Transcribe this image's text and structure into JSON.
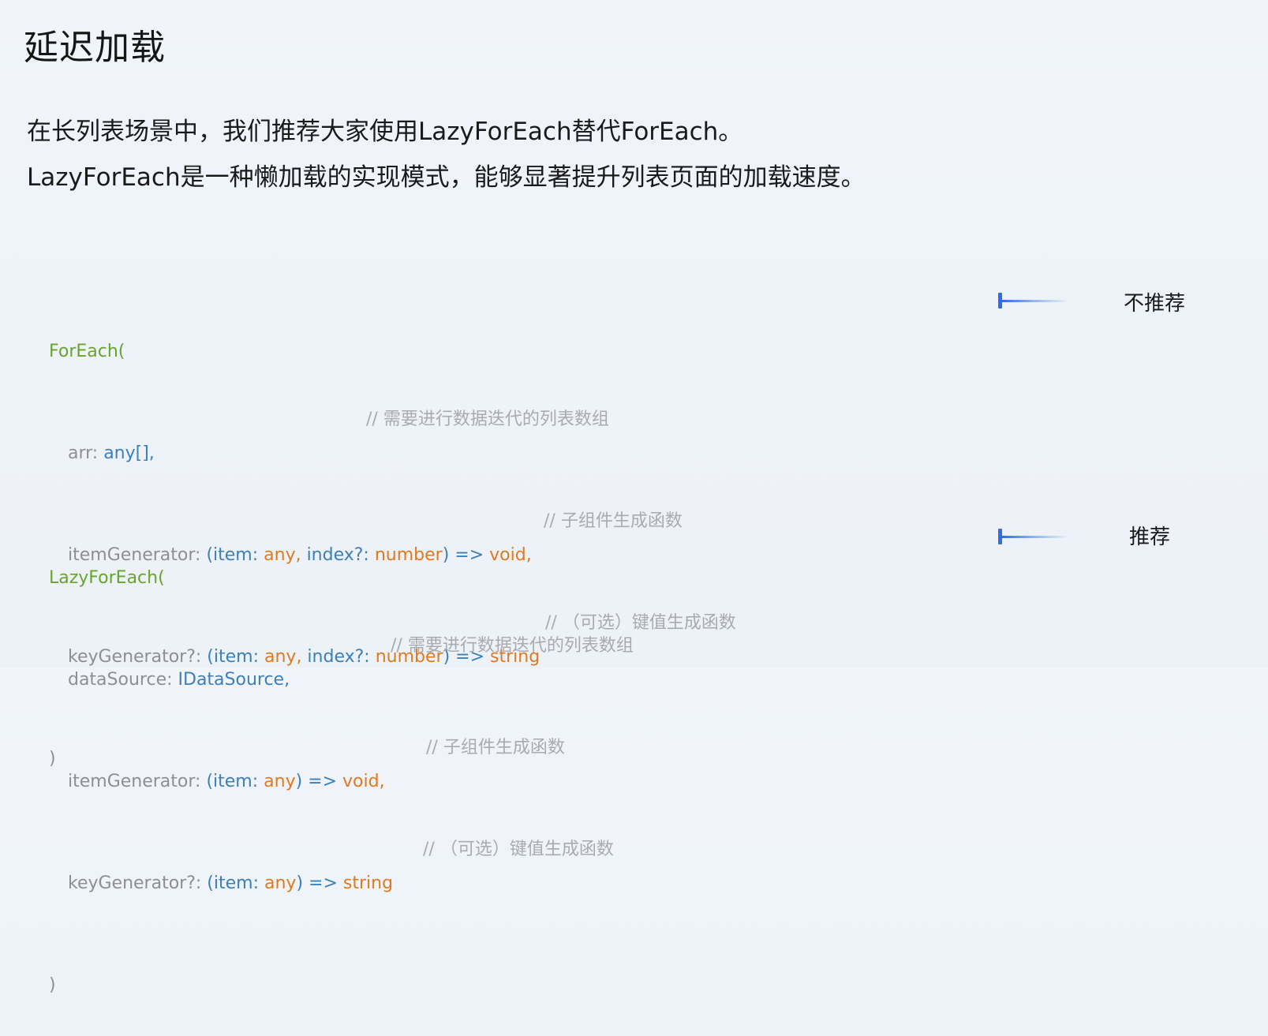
{
  "title": "延迟加载",
  "intro": {
    "line1": "在长列表场景中，我们推荐大家使用LazyForEach替代ForEach。",
    "line2": "LazyForEach是一种懒加载的实现模式，能够显著提升列表页面的加载速度。"
  },
  "foreach_block": {
    "open": "ForEach(",
    "arr_key": "arr: ",
    "arr_type": "any[],",
    "arr_comment": "// 需要进行数据迭代的列表数组",
    "item_key": "itemGenerator: ",
    "item_paren": "(item: ",
    "item_any": "any,",
    "item_index": " index?: ",
    "item_number": "number",
    "item_arrow": ") => ",
    "item_void": "void,",
    "item_comment": "// 子组件生成函数",
    "key_key": "keyGenerator?: ",
    "key_paren": "(item: ",
    "key_any": "any,",
    "key_index": " index?: ",
    "key_number": "number",
    "key_arrow": ") => ",
    "key_string": "string",
    "key_comment": "// （可选）键值生成函数",
    "close": ")",
    "label": "不推荐"
  },
  "lazy_block": {
    "open": "LazyForEach(",
    "ds_key": "dataSource: ",
    "ds_type": "IDataSource,",
    "ds_comment": "// 需要进行数据迭代的列表数组",
    "item_key": "itemGenerator: ",
    "item_paren": "(item: ",
    "item_any": "any",
    "item_arrow": ") => ",
    "item_void": "void,",
    "item_comment": "// 子组件生成函数",
    "key_key": "keyGenerator?: ",
    "key_paren": "(item: ",
    "key_any": "any",
    "key_arrow": ") => ",
    "key_string": "string",
    "key_comment": "// （可选）键值生成函数",
    "close": ")",
    "label": "推荐"
  },
  "colors": {
    "keyword_green": "#68a52c",
    "param_gray": "#8d8f94",
    "type_blue": "#3d7fb8",
    "type_orange": "#e07a1f",
    "comment_gray": "#a9abaf",
    "arrow_blue": "#2f6fe0"
  }
}
